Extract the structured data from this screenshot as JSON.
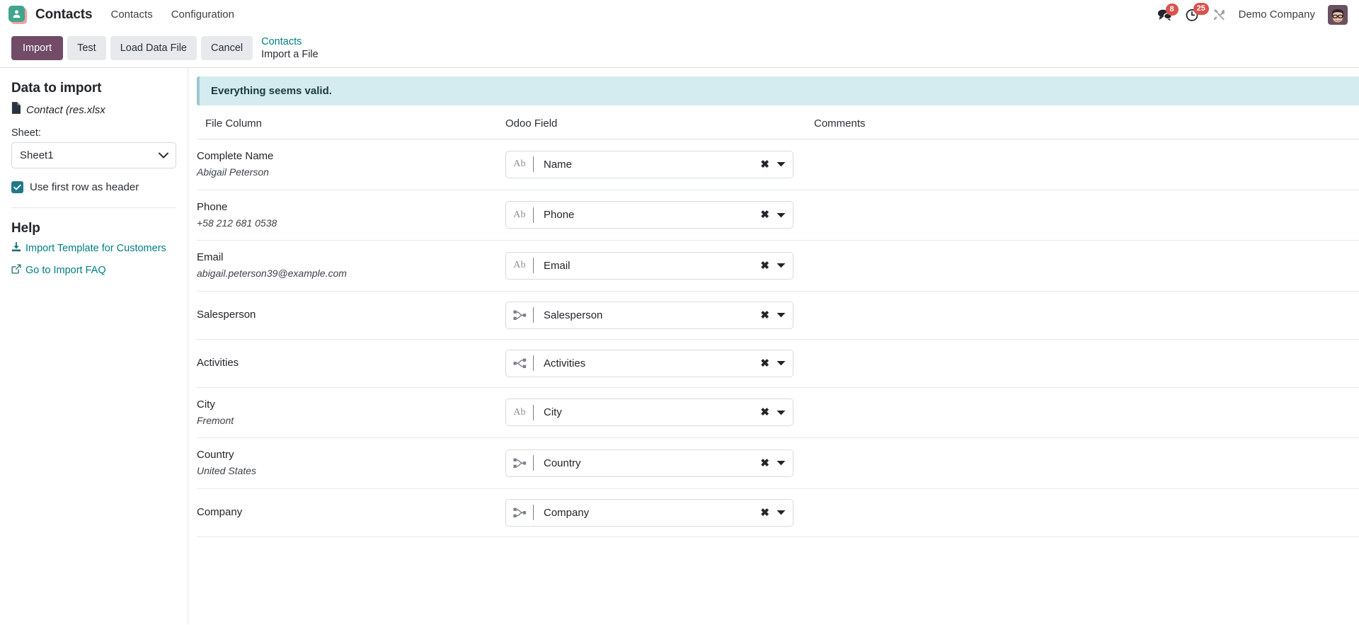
{
  "navbar": {
    "app_icon": "contacts-app-icon",
    "app_title": "Contacts",
    "menu": [
      {
        "label": "Contacts"
      },
      {
        "label": "Configuration"
      }
    ],
    "systray": {
      "messages": {
        "icon": "comments-icon",
        "count": "8"
      },
      "activities": {
        "icon": "clock-icon",
        "count": "25"
      },
      "debug": {
        "icon": "tools-icon"
      }
    },
    "company": "Demo Company",
    "avatar": "user-avatar"
  },
  "toolbar": {
    "import_label": "Import",
    "test_label": "Test",
    "load_data_file_label": "Load Data File",
    "cancel_label": "Cancel"
  },
  "breadcrumb": {
    "parent": "Contacts",
    "current": "Import a File"
  },
  "sidebar": {
    "title": "Data to import",
    "file_icon": "file-icon",
    "file_name": "Contact (res.xlsx",
    "sheet_label": "Sheet:",
    "sheet_selected": "Sheet1",
    "sheet_options": [
      "Sheet1"
    ],
    "use_first_row_label": "Use first row as header",
    "use_first_row_checked": true,
    "help_title": "Help",
    "help_links": [
      {
        "label": "Import Template for Customers",
        "icon": "download-icon"
      },
      {
        "label": "Go to Import FAQ",
        "icon": "external-link-icon"
      }
    ]
  },
  "main": {
    "alert": "Everything seems valid.",
    "columns": {
      "file_column": "File Column",
      "odoo_field": "Odoo Field",
      "comments": "Comments"
    },
    "rows": [
      {
        "file_column": "Complete Name",
        "sample": "Abigail Peterson",
        "odoo_field": "Name",
        "field_type_icon": "char-field-icon",
        "clear_icon": "clear-icon",
        "caret_icon": "caret-down-icon",
        "comment": ""
      },
      {
        "file_column": "Phone",
        "sample": "+58 212 681 0538",
        "odoo_field": "Phone",
        "field_type_icon": "char-field-icon",
        "clear_icon": "clear-icon",
        "caret_icon": "caret-down-icon",
        "comment": ""
      },
      {
        "file_column": "Email",
        "sample": "abigail.peterson39@example.com",
        "odoo_field": "Email",
        "field_type_icon": "char-field-icon",
        "clear_icon": "clear-icon",
        "caret_icon": "caret-down-icon",
        "comment": ""
      },
      {
        "file_column": "Salesperson",
        "sample": "",
        "odoo_field": "Salesperson",
        "field_type_icon": "many2one-field-icon",
        "clear_icon": "clear-icon",
        "caret_icon": "caret-down-icon",
        "comment": ""
      },
      {
        "file_column": "Activities",
        "sample": "",
        "odoo_field": "Activities",
        "field_type_icon": "one2many-field-icon",
        "clear_icon": "clear-icon",
        "caret_icon": "caret-down-icon",
        "comment": ""
      },
      {
        "file_column": "City",
        "sample": "Fremont",
        "odoo_field": "City",
        "field_type_icon": "char-field-icon",
        "clear_icon": "clear-icon",
        "caret_icon": "caret-down-icon",
        "comment": ""
      },
      {
        "file_column": "Country",
        "sample": "United States",
        "odoo_field": "Country",
        "field_type_icon": "many2one-field-icon",
        "clear_icon": "clear-icon",
        "caret_icon": "caret-down-icon",
        "comment": ""
      },
      {
        "file_column": "Company",
        "sample": "",
        "odoo_field": "Company",
        "field_type_icon": "many2one-field-icon",
        "clear_icon": "clear-icon",
        "caret_icon": "caret-down-icon",
        "comment": ""
      }
    ]
  },
  "colors": {
    "primary": "#714b67",
    "link": "#017e84",
    "badge": "#d9534f",
    "alert_bg": "#d4ecef",
    "checkbox": "#20798a"
  }
}
